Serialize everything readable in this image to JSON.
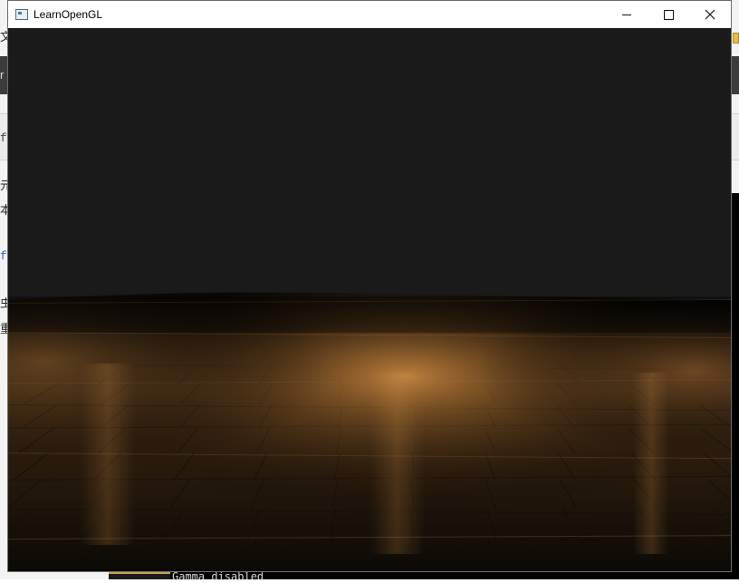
{
  "window": {
    "title": "LearnOpenGL",
    "controls": [
      "minimize",
      "maximize",
      "close"
    ],
    "icons": {
      "app": "window-app-icon",
      "minimize": "minimize-icon",
      "maximize": "maximize-icon",
      "close": "close-icon"
    }
  },
  "scene": {
    "clear_color": "#1a1a1a",
    "floor_light_color": "#c88a48",
    "floor_dark_color": "#050403"
  },
  "background": {
    "edge_chars": [
      "文",
      "r",
      "f",
      "元",
      "本",
      "f",
      "虫",
      "重"
    ],
    "console_text": "Gamma disabled"
  }
}
